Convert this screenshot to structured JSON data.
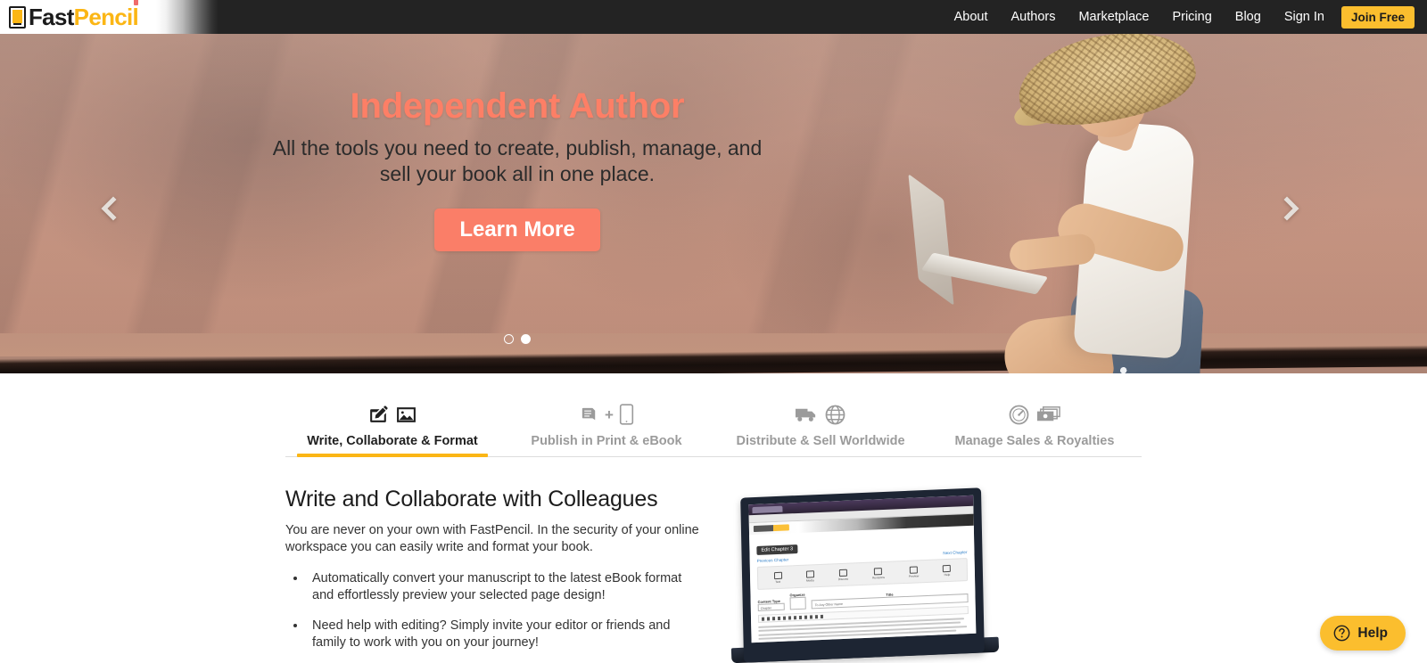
{
  "brand": {
    "logo_fast": "Fast",
    "logo_pencil": "Pencil",
    "logo_icon": "book-tablet-icon",
    "accent_yellow": "#fbb615",
    "accent_coral": "#fa7e68",
    "header_bg": "#232323"
  },
  "nav": {
    "items": [
      {
        "label": "About"
      },
      {
        "label": "Authors"
      },
      {
        "label": "Marketplace"
      },
      {
        "label": "Pricing"
      },
      {
        "label": "Blog"
      },
      {
        "label": "Sign In"
      }
    ],
    "cta": {
      "label": "Join Free",
      "color": "#fbbe2e"
    }
  },
  "hero": {
    "title": "Independent Author",
    "title_color": "#fd7f66",
    "subtitle": "All the tools you need to create, publish, manage, and sell your book all in one place.",
    "cta": {
      "label": "Learn More",
      "color": "#fa7e68"
    },
    "prev_arrow_icon": "chevron-left-icon",
    "next_arrow_icon": "chevron-right-icon",
    "slides": 2,
    "active_slide": 2
  },
  "tabs": [
    {
      "label": "Write, Collaborate & Format",
      "active": true,
      "icons": [
        "pencil-edit-icon",
        "image-icon"
      ]
    },
    {
      "label": "Publish in Print & eBook",
      "active": false,
      "icons": [
        "book-icon",
        "plus-sign",
        "tablet-icon"
      ],
      "separator": "+"
    },
    {
      "label": "Distribute & Sell Worldwide",
      "active": false,
      "icons": [
        "truck-icon",
        "globe-icon"
      ]
    },
    {
      "label": "Manage Sales & Royalties",
      "active": false,
      "icons": [
        "speedometer-icon",
        "money-icon"
      ]
    }
  ],
  "panel": {
    "heading": "Write and Collaborate with Colleagues",
    "paragraph": "You are never on your own with FastPencil. In the security of your online workspace you can easily write and format your book.",
    "bullets": [
      "Automatically convert your manuscript to the latest eBook format and effortlessly preview your selected page design!",
      "Need help with editing?  Simply invite your editor or friends and family to work with you on your journey!"
    ],
    "screenshot": {
      "alt": "fastpencil-editor-laptop",
      "app_title": "Edit Chapter 3",
      "prev_link": "Previous Chapter",
      "next_link": "Next Chapter",
      "toolbar": [
        {
          "label": "Text"
        },
        {
          "label": "Media"
        },
        {
          "label": "Discuss"
        },
        {
          "label": "Revisions"
        },
        {
          "label": "Preview"
        },
        {
          "label": "Help"
        }
      ],
      "fields": {
        "content_type_label": "Content Type",
        "content_type_value": "Chapter",
        "organize_label": "Organize",
        "title_label": "Title",
        "title_value": "To Any Other Name"
      },
      "save_label": "Need Save to Print"
    }
  },
  "help": {
    "label": "Help",
    "icon": "question-circle-icon",
    "color": "#fbbe2e"
  }
}
